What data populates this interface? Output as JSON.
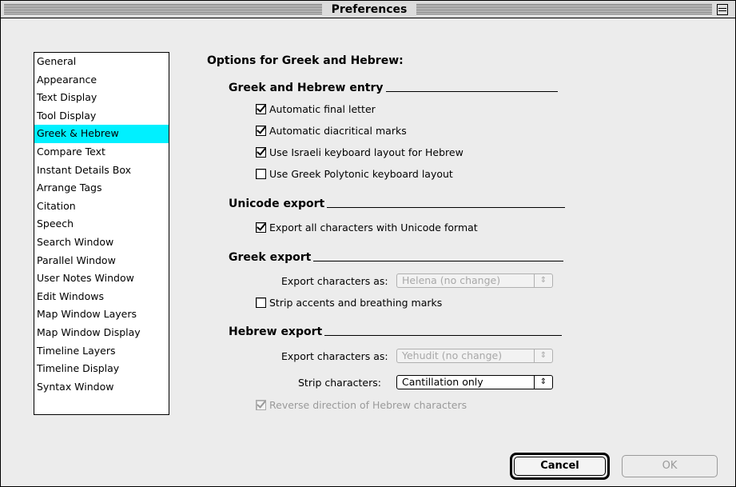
{
  "window": {
    "title": "Preferences"
  },
  "categories": {
    "items": [
      "General",
      "Appearance",
      "Text Display",
      "Tool Display",
      "Greek & Hebrew",
      "Compare Text",
      "Instant Details Box",
      "Arrange Tags",
      "Citation",
      "Speech",
      "Search Window",
      "Parallel Window",
      "User Notes Window",
      "Edit Windows",
      "Map Window Layers",
      "Map Window Display",
      "Timeline Layers",
      "Timeline Display",
      "Syntax Window"
    ],
    "selected": "Greek & Hebrew"
  },
  "main": {
    "heading": "Options for Greek and Hebrew:",
    "entry": {
      "title": "Greek and Hebrew entry",
      "automatic_final_letter": "Automatic final letter",
      "automatic_diacritical": "Automatic diacritical marks",
      "israeli_layout": "Use Israeli keyboard layout for Hebrew",
      "polytonic_layout": "Use Greek Polytonic keyboard layout"
    },
    "unicode": {
      "title": "Unicode export",
      "export_all": "Export all characters with Unicode format"
    },
    "greek_export": {
      "title": "Greek export",
      "export_as_label": "Export characters as:",
      "export_as_value": "Helena (no change)",
      "strip_accents": "Strip accents and breathing marks"
    },
    "hebrew_export": {
      "title": "Hebrew export",
      "export_as_label": "Export characters as:",
      "export_as_value": "Yehudit (no change)",
      "strip_label": "Strip characters:",
      "strip_value": "Cantillation only",
      "reverse_direction": "Reverse direction of Hebrew characters"
    }
  },
  "buttons": {
    "cancel": "Cancel",
    "ok": "OK"
  },
  "icons": {
    "collapse": "collapse-box-icon",
    "checkmark": "checkmark-icon",
    "popup_arrows": "updown-arrows-icon"
  },
  "colors": {
    "selection": "#00f0ff",
    "window_bg": "#ececec"
  }
}
